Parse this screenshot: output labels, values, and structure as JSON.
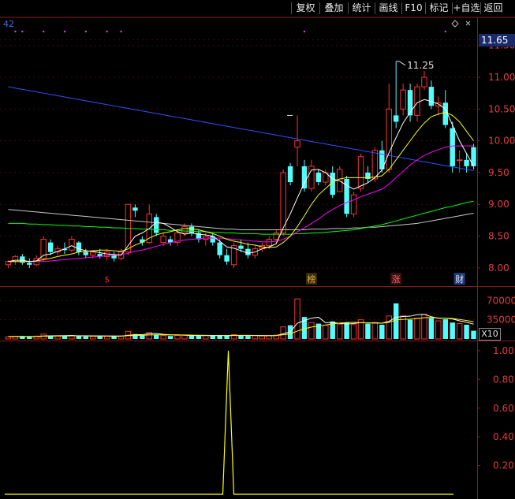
{
  "toolbar": {
    "buttons": [
      "复权",
      "叠加",
      "统计",
      "画线",
      "F10",
      "标记",
      "+自选",
      "返回"
    ]
  },
  "corner_label": "42",
  "price_panel": {
    "current_price": "11.65",
    "y_ticks": [
      "11.50",
      "11.00",
      "10.50",
      "10.00",
      "9.50",
      "9.00",
      "8.50",
      "8.00"
    ],
    "ylim": [
      7.75,
      11.72
    ],
    "high_annotation": "11.25",
    "markers": [
      {
        "label": "$",
        "color": "#e02020",
        "bg": "#000000",
        "index": 14
      },
      {
        "label": "榜",
        "color": "#e0b040",
        "bg": "#3a2a10",
        "index": 43
      },
      {
        "label": "涨",
        "color": "#ff6060",
        "bg": "#3a1010",
        "index": 55
      },
      {
        "label": "财",
        "color": "#d8e8ff",
        "bg": "#243a78",
        "index": 64
      }
    ],
    "colors": {
      "up": "#ff3232",
      "down": "#54fcfc",
      "ma5": "#ffffff",
      "ma10": "#ffff00",
      "ma20": "#ff00ff",
      "ma60": "#00ff00",
      "ma120": "#c8c8c8",
      "ma250": "#3050ff"
    }
  },
  "volume_panel": {
    "y_ticks": [
      "70000",
      "35000"
    ],
    "ylim": [
      0,
      92000
    ],
    "multiplier_label": "X10"
  },
  "indicator_panel": {
    "y_ticks": [
      "1.00",
      "0.80",
      "0.60",
      "0.40",
      "0.20"
    ],
    "ylim": [
      0,
      1.06
    ],
    "color": "#ffff00"
  },
  "chart_data": {
    "type": "candlestick",
    "ohlc": [
      [
        8.05,
        8.12,
        8.0,
        8.1
      ],
      [
        8.1,
        8.2,
        8.05,
        8.18
      ],
      [
        8.18,
        8.22,
        8.05,
        8.08
      ],
      [
        8.08,
        8.15,
        8.0,
        8.05
      ],
      [
        8.05,
        8.2,
        8.03,
        8.15
      ],
      [
        8.15,
        8.5,
        8.1,
        8.45
      ],
      [
        8.4,
        8.45,
        8.2,
        8.25
      ],
      [
        8.25,
        8.35,
        8.2,
        8.3
      ],
      [
        8.3,
        8.4,
        8.22,
        8.28
      ],
      [
        8.28,
        8.5,
        8.25,
        8.45
      ],
      [
        8.4,
        8.42,
        8.2,
        8.25
      ],
      [
        8.25,
        8.3,
        8.15,
        8.2
      ],
      [
        8.2,
        8.28,
        8.15,
        8.25
      ],
      [
        8.22,
        8.3,
        8.15,
        8.18
      ],
      [
        8.18,
        8.3,
        8.12,
        8.25
      ],
      [
        8.2,
        8.25,
        8.1,
        8.15
      ],
      [
        8.15,
        8.3,
        8.12,
        8.25
      ],
      [
        8.25,
        9.0,
        8.2,
        9.0
      ],
      [
        8.95,
        9.0,
        8.8,
        8.9
      ],
      [
        8.45,
        8.5,
        8.35,
        8.4
      ],
      [
        8.4,
        9.0,
        8.38,
        8.85
      ],
      [
        8.8,
        8.85,
        8.5,
        8.55
      ],
      [
        8.4,
        8.55,
        8.35,
        8.5
      ],
      [
        8.45,
        8.5,
        8.35,
        8.4
      ],
      [
        8.4,
        8.6,
        8.35,
        8.55
      ],
      [
        8.55,
        8.7,
        8.5,
        8.65
      ],
      [
        8.65,
        8.7,
        8.5,
        8.55
      ],
      [
        8.55,
        8.6,
        8.4,
        8.45
      ],
      [
        8.45,
        8.55,
        8.35,
        8.5
      ],
      [
        8.5,
        8.55,
        8.35,
        8.4
      ],
      [
        8.4,
        8.45,
        8.15,
        8.2
      ],
      [
        8.2,
        8.3,
        8.05,
        8.1
      ],
      [
        8.05,
        8.4,
        8.0,
        8.35
      ],
      [
        8.35,
        8.45,
        8.25,
        8.3
      ],
      [
        8.3,
        8.4,
        8.15,
        8.2
      ],
      [
        8.2,
        8.35,
        8.15,
        8.3
      ],
      [
        8.3,
        8.4,
        8.25,
        8.35
      ],
      [
        8.35,
        8.5,
        8.3,
        8.45
      ],
      [
        8.45,
        8.6,
        8.4,
        8.55
      ],
      [
        8.55,
        9.55,
        8.5,
        9.5
      ],
      [
        9.6,
        9.65,
        9.3,
        9.35
      ],
      [
        9.9,
        10.4,
        9.6,
        10.0
      ],
      [
        9.6,
        9.7,
        9.2,
        9.25
      ],
      [
        9.25,
        9.7,
        9.2,
        9.6
      ],
      [
        9.5,
        9.55,
        9.3,
        9.35
      ],
      [
        9.35,
        9.55,
        9.3,
        9.5
      ],
      [
        9.5,
        9.6,
        9.1,
        9.15
      ],
      [
        9.2,
        9.6,
        9.2,
        9.55
      ],
      [
        9.4,
        9.45,
        8.8,
        8.85
      ],
      [
        8.85,
        9.2,
        8.8,
        9.15
      ],
      [
        9.25,
        9.8,
        9.2,
        9.75
      ],
      [
        9.5,
        9.6,
        9.35,
        9.4
      ],
      [
        9.4,
        9.9,
        9.35,
        9.85
      ],
      [
        9.85,
        10.0,
        9.5,
        9.55
      ],
      [
        9.55,
        10.9,
        9.5,
        10.5
      ],
      [
        10.4,
        11.25,
        10.2,
        10.3
      ],
      [
        10.5,
        10.9,
        10.4,
        10.8
      ],
      [
        10.8,
        10.9,
        10.3,
        10.4
      ],
      [
        10.4,
        10.9,
        10.3,
        10.85
      ],
      [
        10.85,
        11.1,
        10.8,
        11.0
      ],
      [
        10.85,
        10.95,
        10.5,
        10.55
      ],
      [
        10.55,
        10.7,
        10.4,
        10.6
      ],
      [
        10.6,
        10.8,
        10.2,
        10.25
      ],
      [
        10.2,
        10.3,
        9.5,
        9.6
      ],
      [
        9.7,
        9.85,
        9.5,
        9.7
      ],
      [
        9.7,
        9.8,
        9.5,
        9.6
      ],
      [
        9.9,
        9.95,
        9.55,
        9.6
      ]
    ],
    "ma5": [
      8.1,
      8.12,
      8.12,
      8.1,
      8.11,
      8.2,
      8.22,
      8.26,
      8.3,
      8.35,
      8.3,
      8.27,
      8.26,
      8.24,
      8.22,
      8.21,
      8.2,
      8.35,
      8.5,
      8.55,
      8.62,
      8.72,
      8.7,
      8.64,
      8.57,
      8.53,
      8.55,
      8.53,
      8.52,
      8.5,
      8.42,
      8.33,
      8.31,
      8.27,
      8.23,
      8.25,
      8.3,
      8.33,
      8.38,
      8.63,
      8.85,
      9.1,
      9.34,
      9.54,
      9.55,
      9.5,
      9.4,
      9.37,
      9.3,
      9.24,
      9.29,
      9.34,
      9.42,
      9.54,
      9.81,
      10.05,
      10.28,
      10.45,
      10.6,
      10.65,
      10.62,
      10.58,
      10.5,
      10.25,
      10.0,
      9.8,
      9.6
    ],
    "ma10": [
      8.1,
      8.1,
      8.1,
      8.1,
      8.11,
      8.13,
      8.15,
      8.18,
      8.2,
      8.22,
      8.25,
      8.26,
      8.27,
      8.28,
      8.28,
      8.27,
      8.26,
      8.3,
      8.36,
      8.4,
      8.47,
      8.52,
      8.55,
      8.57,
      8.6,
      8.62,
      8.62,
      8.6,
      8.57,
      8.54,
      8.5,
      8.45,
      8.42,
      8.4,
      8.37,
      8.36,
      8.33,
      8.32,
      8.33,
      8.4,
      8.5,
      8.65,
      8.82,
      9.0,
      9.15,
      9.25,
      9.35,
      9.4,
      9.42,
      9.42,
      9.42,
      9.42,
      9.43,
      9.45,
      9.55,
      9.7,
      9.85,
      10.0,
      10.15,
      10.28,
      10.38,
      10.42,
      10.45,
      10.4,
      10.3,
      10.15,
      10.0
    ],
    "ma20": [
      8.1,
      8.1,
      8.1,
      8.1,
      8.1,
      8.1,
      8.11,
      8.12,
      8.13,
      8.14,
      8.15,
      8.16,
      8.17,
      8.18,
      8.19,
      8.2,
      8.21,
      8.23,
      8.26,
      8.28,
      8.31,
      8.34,
      8.37,
      8.4,
      8.42,
      8.44,
      8.45,
      8.46,
      8.47,
      8.47,
      8.47,
      8.46,
      8.45,
      8.44,
      8.43,
      8.42,
      8.41,
      8.41,
      8.42,
      8.45,
      8.5,
      8.57,
      8.63,
      8.7,
      8.77,
      8.85,
      8.92,
      8.98,
      9.03,
      9.07,
      9.12,
      9.16,
      9.2,
      9.24,
      9.32,
      9.42,
      9.52,
      9.62,
      9.7,
      9.77,
      9.82,
      9.86,
      9.9,
      9.92,
      9.92,
      9.92,
      9.92
    ],
    "ma60": [
      8.7,
      8.7,
      8.7,
      8.69,
      8.69,
      8.68,
      8.68,
      8.67,
      8.67,
      8.66,
      8.66,
      8.65,
      8.65,
      8.64,
      8.64,
      8.63,
      8.63,
      8.62,
      8.62,
      8.61,
      8.61,
      8.6,
      8.6,
      8.59,
      8.59,
      8.58,
      8.58,
      8.57,
      8.57,
      8.56,
      8.56,
      8.55,
      8.55,
      8.54,
      8.54,
      8.54,
      8.53,
      8.53,
      8.53,
      8.53,
      8.53,
      8.54,
      8.54,
      8.55,
      8.55,
      8.56,
      8.57,
      8.58,
      8.59,
      8.6,
      8.62,
      8.64,
      8.66,
      8.68,
      8.71,
      8.74,
      8.77,
      8.8,
      8.83,
      8.86,
      8.89,
      8.92,
      8.95,
      8.97,
      9.0,
      9.03,
      9.05
    ],
    "ma120": [
      8.92,
      8.91,
      8.9,
      8.89,
      8.88,
      8.87,
      8.86,
      8.85,
      8.84,
      8.83,
      8.82,
      8.81,
      8.8,
      8.79,
      8.78,
      8.77,
      8.76,
      8.75,
      8.74,
      8.73,
      8.72,
      8.71,
      8.7,
      8.69,
      8.68,
      8.67,
      8.66,
      8.65,
      8.64,
      8.63,
      8.62,
      8.61,
      8.61,
      8.6,
      8.6,
      8.6,
      8.6,
      8.6,
      8.6,
      8.6,
      8.6,
      8.6,
      8.6,
      8.61,
      8.61,
      8.61,
      8.62,
      8.62,
      8.62,
      8.63,
      8.63,
      8.64,
      8.64,
      8.65,
      8.66,
      8.67,
      8.68,
      8.69,
      8.7,
      8.72,
      8.74,
      8.76,
      8.78,
      8.8,
      8.82,
      8.84,
      8.86
    ],
    "ma250": [
      10.85,
      10.83,
      10.81,
      10.79,
      10.77,
      10.75,
      10.73,
      10.71,
      10.69,
      10.67,
      10.65,
      10.63,
      10.61,
      10.59,
      10.57,
      10.55,
      10.53,
      10.51,
      10.49,
      10.47,
      10.45,
      10.43,
      10.41,
      10.39,
      10.37,
      10.35,
      10.33,
      10.31,
      10.29,
      10.27,
      10.25,
      10.23,
      10.21,
      10.19,
      10.17,
      10.15,
      10.13,
      10.11,
      10.09,
      10.07,
      10.05,
      10.03,
      10.01,
      9.99,
      9.97,
      9.95,
      9.93,
      9.91,
      9.89,
      9.87,
      9.85,
      9.83,
      9.81,
      9.79,
      9.77,
      9.75,
      9.73,
      9.71,
      9.69,
      9.67,
      9.65,
      9.63,
      9.61,
      9.59,
      9.57,
      9.55,
      9.53
    ],
    "volume": [
      4000,
      5000,
      4500,
      3800,
      5200,
      9000,
      6000,
      5500,
      5000,
      6500,
      5200,
      4800,
      5000,
      4600,
      5000,
      4500,
      5500,
      14000,
      9000,
      7000,
      12000,
      8000,
      6000,
      5500,
      6500,
      7000,
      6000,
      5500,
      6000,
      5800,
      7000,
      6500,
      8000,
      6000,
      5500,
      6000,
      5500,
      6500,
      7000,
      22000,
      25000,
      73000,
      40000,
      30000,
      28000,
      25000,
      32000,
      27000,
      30000,
      26000,
      35000,
      28000,
      30000,
      26000,
      42000,
      65000,
      42000,
      35000,
      38000,
      45000,
      38000,
      33000,
      36000,
      30000,
      28000,
      26000,
      15000
    ],
    "volume_ma5": [
      4500,
      4500,
      4600,
      4500,
      4500,
      5500,
      5700,
      5900,
      6100,
      6400,
      5640,
      5600,
      5300,
      5220,
      5200,
      4980,
      5000,
      6880,
      7580,
      8000,
      9500,
      10000,
      8400,
      7700,
      7600,
      6800,
      6200,
      6100,
      6200,
      6160,
      6060,
      6160,
      6660,
      6660,
      6600,
      6400,
      6200,
      6000,
      6100,
      9500,
      13200,
      28700,
      33400,
      38000,
      39600,
      29600,
      30200,
      28400,
      27400,
      28000,
      30000,
      29200,
      29400,
      29000,
      32200,
      39600,
      41000,
      41600,
      44400,
      45000,
      40600,
      37800,
      38000,
      36400,
      33000,
      30600,
      27000
    ],
    "volume_ma10": [
      4500,
      4500,
      4500,
      4500,
      4500,
      5000,
      5200,
      5400,
      5600,
      5800,
      5900,
      5900,
      5800,
      5700,
      5600,
      5500,
      5400,
      6000,
      6400,
      6600,
      7300,
      7600,
      7500,
      7400,
      7400,
      7300,
      7000,
      6800,
      6600,
      6500,
      6400,
      6300,
      6300,
      6300,
      6300,
      6200,
      6100,
      6100,
      6200,
      7700,
      9400,
      14500,
      18500,
      21700,
      23600,
      25600,
      27500,
      29000,
      30200,
      30300,
      29800,
      29600,
      28900,
      28700,
      30400,
      34800,
      35800,
      36100,
      37300,
      38800,
      39100,
      38300,
      38100,
      37300,
      35600,
      33700,
      31400
    ],
    "indicator": [
      0,
      0,
      0,
      0,
      0,
      0,
      0,
      0,
      0,
      0,
      0,
      0,
      0,
      0,
      0,
      0,
      0,
      0,
      0,
      0,
      0,
      0,
      0,
      0,
      0,
      0,
      0,
      0,
      0,
      0,
      0,
      0,
      0,
      0,
      0,
      0,
      0,
      0,
      0,
      0,
      0,
      0,
      0,
      0,
      0,
      0,
      0,
      0,
      0,
      0,
      0,
      0,
      0,
      0,
      0,
      0,
      0,
      0,
      0,
      0,
      0,
      0,
      0,
      0,
      0,
      0,
      0
    ],
    "indicator_spike": {
      "x_fraction": 0.5,
      "value": 1.0
    }
  }
}
